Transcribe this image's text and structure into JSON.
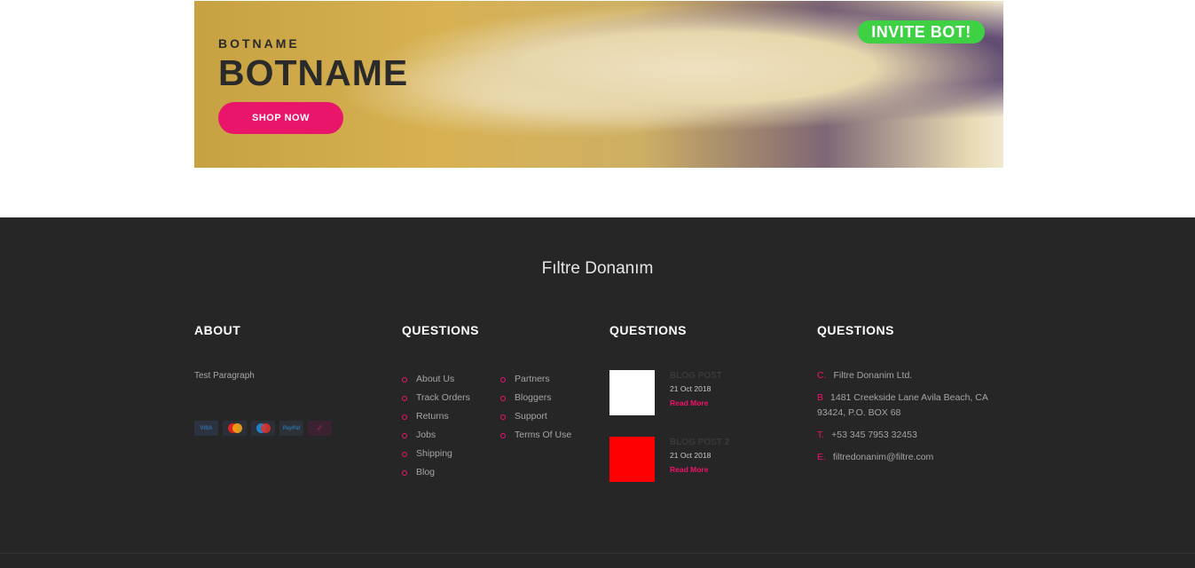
{
  "banner": {
    "small_title": "BOTNAME",
    "big_title": "BOTNAME",
    "shop_button": "SHOP NOW",
    "invite_button": "INVITE BOT!"
  },
  "footer": {
    "brand": "Fıltre Donanım",
    "about": {
      "title": "ABOUT",
      "text": "Test Paragraph",
      "cards": [
        "VISA",
        "MasterCard",
        "Maestro",
        "PayPal",
        "✓"
      ]
    },
    "questions1": {
      "title": "QUESTIONS",
      "col_a": [
        "About Us",
        "Track Orders",
        "Returns",
        "Jobs",
        "Shipping",
        "Blog"
      ],
      "col_b": [
        "Partners",
        "Bloggers",
        "Support",
        "Terms Of Use"
      ]
    },
    "questions2": {
      "title": "QUESTIONS",
      "posts": [
        {
          "title": "BLOG POST",
          "date": "21 Oct 2018",
          "more": "Read More",
          "color": "#ffffff"
        },
        {
          "title": "BLOG POST 2",
          "date": "21 Oct 2018",
          "more": "Read More",
          "color": "#ff0000"
        }
      ]
    },
    "questions3": {
      "title": "QUESTIONS",
      "company_label": "C.",
      "company": "Filtre Donanim Ltd.",
      "address_label": "B",
      "address": "1481 Creekside Lane Avila Beach, CA 93424, P.O. BOX 68",
      "phone_label": "T.",
      "phone": "+53 345 7953 32453",
      "email_label": "E.",
      "email": "filtredonanim@filtre.com"
    }
  },
  "colors": {
    "accent": "#f0126c",
    "invite": "#39d33f",
    "footer_bg": "#262626"
  }
}
